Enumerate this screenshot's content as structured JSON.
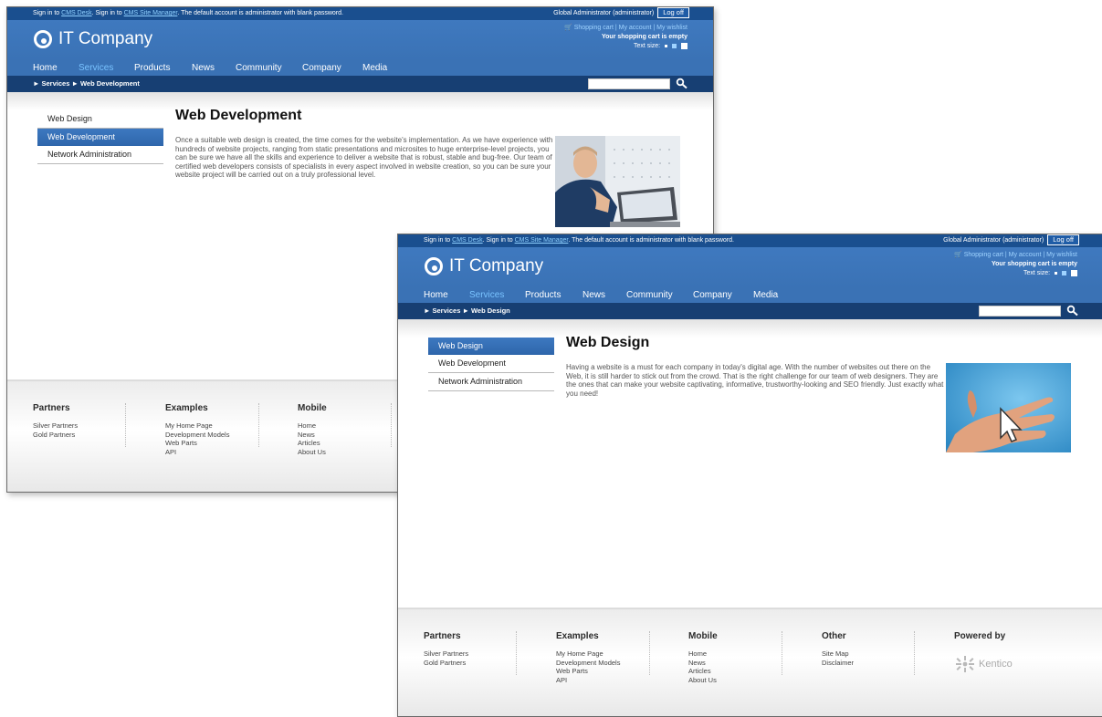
{
  "topbar": {
    "prefix1": "Sign in to ",
    "cms_desk": "CMS Desk",
    "mid": ". Sign in to ",
    "site_manager": "CMS Site Manager",
    "suffix": ". The default account is administrator with blank password.",
    "user": "Global Administrator (administrator)",
    "logoff": "Log off"
  },
  "header": {
    "logo_text": "IT Company",
    "shopping_cart": "Shopping cart",
    "my_account": "My account",
    "my_wishlist": "My wishlist",
    "sep": "|",
    "cart_status": "Your shopping cart is empty",
    "text_size": "Text size:"
  },
  "nav": [
    "Home",
    "Services",
    "Products",
    "News",
    "Community",
    "Company",
    "Media"
  ],
  "breadcrumb_prefix": "► Services ►",
  "window_back": {
    "breadcrumb_current": "Web Development",
    "title": "Web Development",
    "body": "Once a suitable web design is created, the time comes for the website's implementation. As we have experience with hundreds of website projects, ranging from static presentations and microsites to huge enterprise-level projects, you can be sure we have all the skills and experience to deliver a website that is robust, stable and bug-free. Our team of certified web developers consists of specialists in every aspect involved in website creation, so you can be sure your website project will be carried out on a truly professional level."
  },
  "window_front": {
    "breadcrumb_current": "Web Design",
    "title": "Web Design",
    "body": "Having a website is a must for each company in today's digital age. With the number of websites out there on the Web, it is still harder to stick out from the crowd. That is the right challenge for our team of web designers. They are the ones that can make your website captivating, informative, trustworthy-looking and SEO friendly. Just exactly what you need!"
  },
  "sidebar": [
    "Web Design",
    "Web Development",
    "Network Administration"
  ],
  "footer": {
    "partners": {
      "heading": "Partners",
      "items": [
        "Silver Partners",
        "Gold Partners"
      ]
    },
    "examples": {
      "heading": "Examples",
      "items": [
        "My Home Page",
        "Development Models",
        "Web Parts",
        "API"
      ]
    },
    "mobile": {
      "heading": "Mobile",
      "items": [
        "Home",
        "News",
        "Articles",
        "About Us"
      ]
    },
    "other": {
      "heading": "Other",
      "items": [
        "Site Map",
        "Disclaimer"
      ]
    },
    "powered": {
      "heading": "Powered by",
      "brand": "Kentico"
    }
  },
  "colors": {
    "header_blue": "#3a72b5",
    "topbar_blue": "#1a4f8f",
    "breadcrumb_navy": "#173f73",
    "nav_active": "#79c3ff"
  }
}
